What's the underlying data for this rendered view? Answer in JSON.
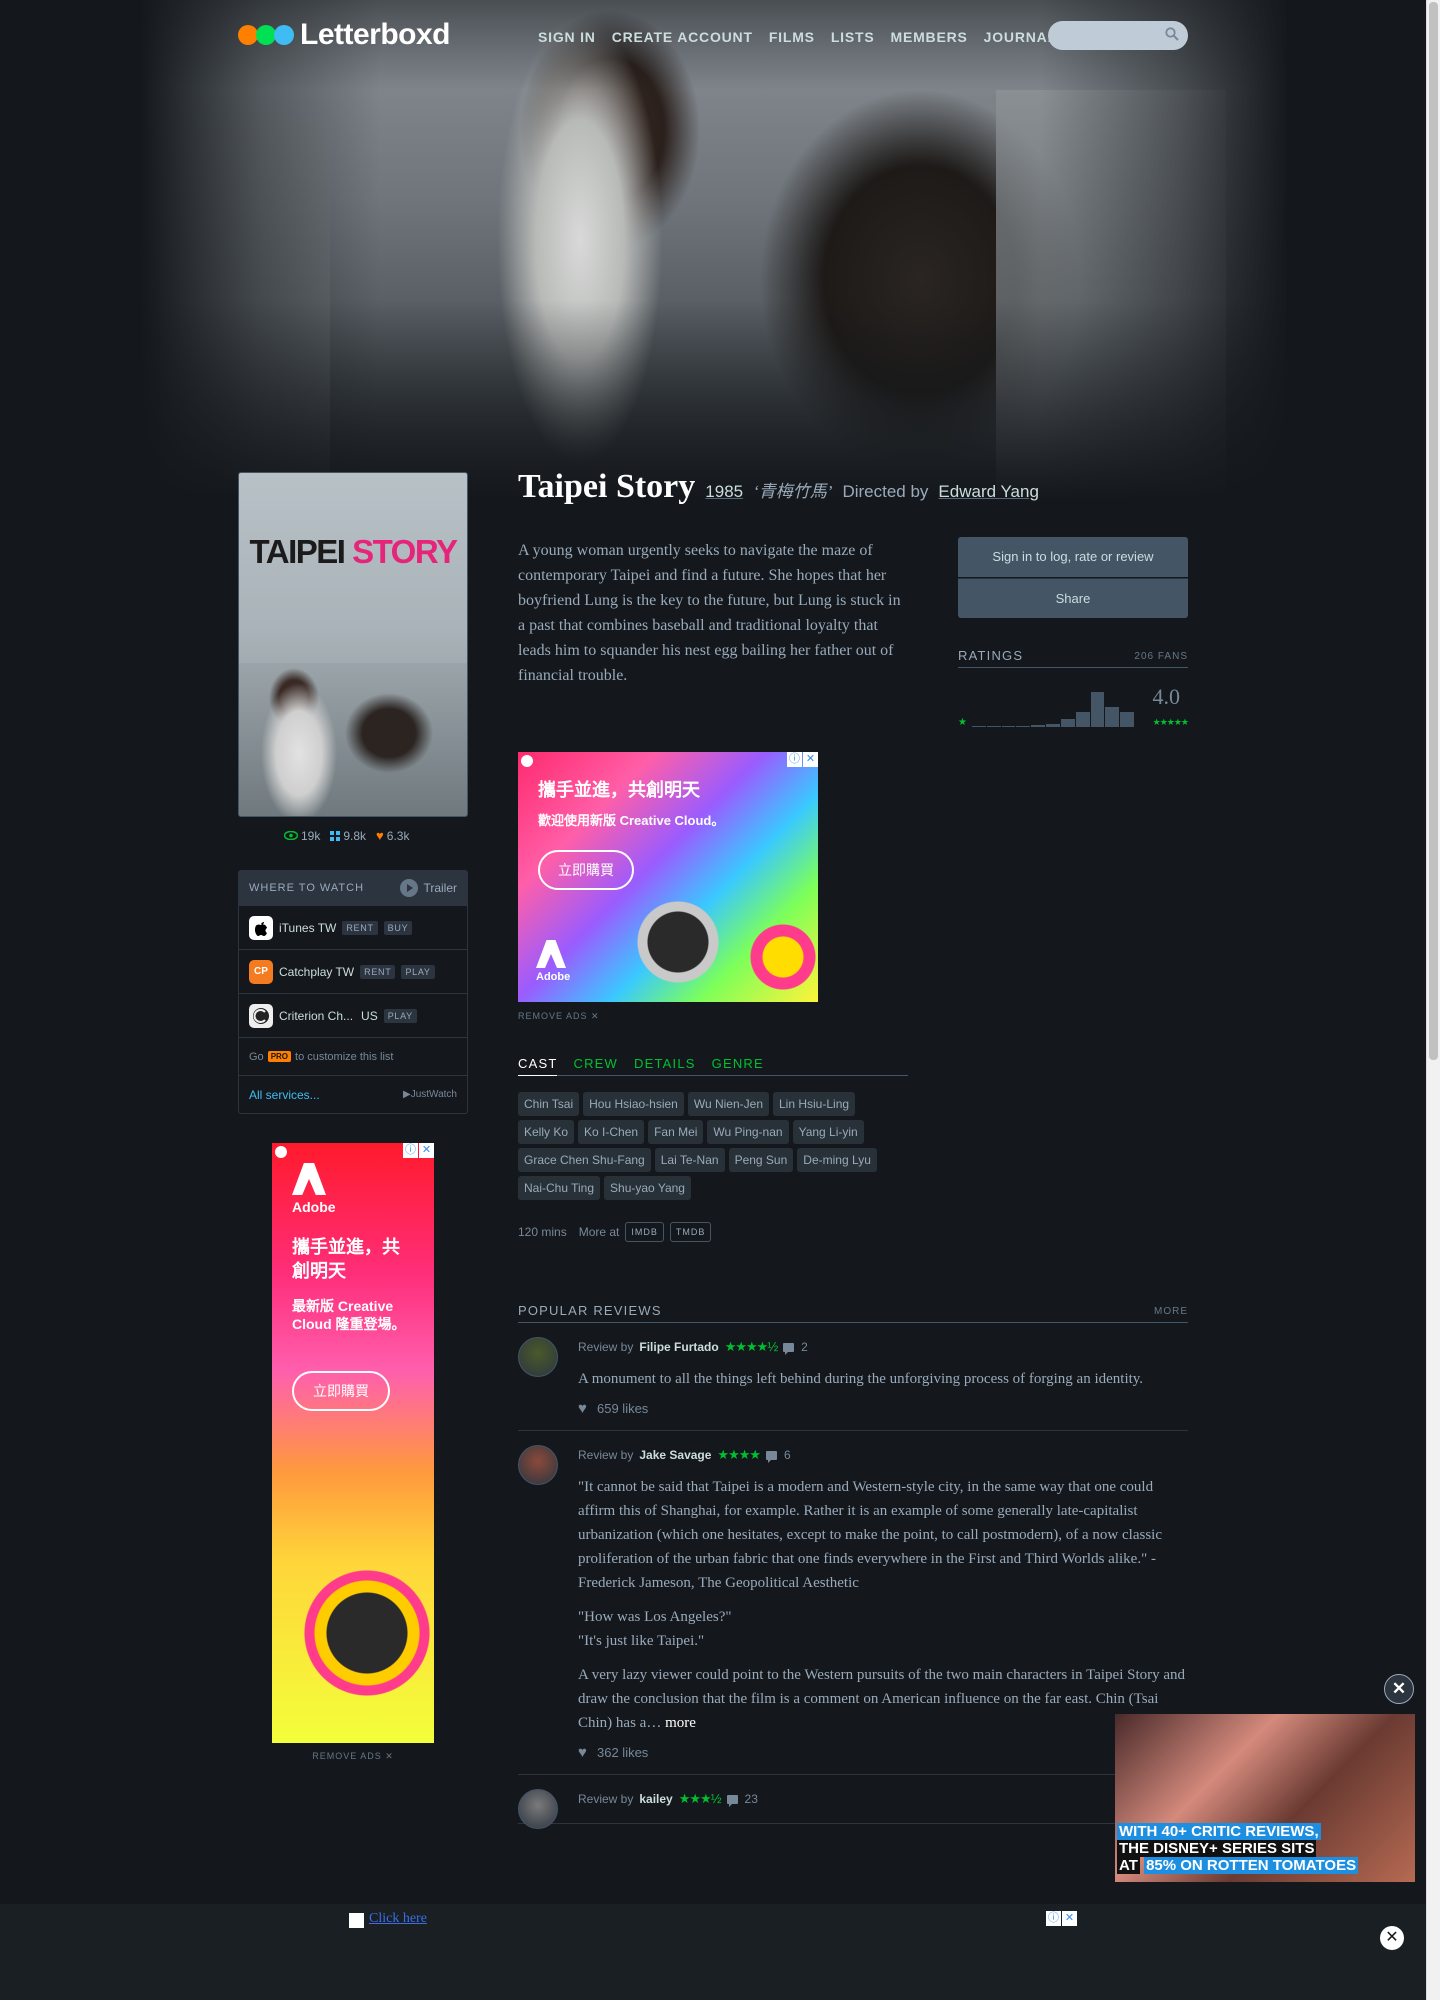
{
  "brand": {
    "name": "Letterboxd",
    "dot_colors": [
      "#ff8000",
      "#00e054",
      "#40bcf4"
    ]
  },
  "nav": {
    "items": [
      "Sign in",
      "Create account",
      "Films",
      "Lists",
      "Members",
      "Journal"
    ]
  },
  "search": {
    "placeholder": ""
  },
  "poster": {
    "title_word1": "TAIPEI",
    "title_word2": "STORY"
  },
  "stats": {
    "watched": "19k",
    "lists": "9.8k",
    "likes": "6.3k"
  },
  "watch": {
    "title": "Where to watch",
    "trailer": "Trailer",
    "services": [
      {
        "name": "iTunes TW",
        "region": "",
        "tags": [
          "RENT",
          "BUY"
        ],
        "icon": "apple-icon"
      },
      {
        "name": "Catchplay TW",
        "region": "",
        "tags": [
          "RENT",
          "PLAY"
        ],
        "icon": "catchplay-icon"
      },
      {
        "name": "Criterion Ch...",
        "region": "US",
        "tags": [
          "PLAY"
        ],
        "icon": "criterion-icon"
      }
    ],
    "note_go": "Go",
    "note_pro": "PRO",
    "note_rest": "to customize this list",
    "all_services": "All services...",
    "justwatch": "JustWatch"
  },
  "ads": {
    "remove": "Remove ads",
    "vertical": {
      "brand": "Adobe",
      "headline": "攜手並進，共創明天",
      "sub": "最新版 Creative Cloud 隆重登場。",
      "button": "立即購買"
    },
    "rect": {
      "brand": "Adobe",
      "headline": "攜手並進，共創明天",
      "sub": "歡迎使用新版 Creative Cloud。",
      "button": "立即購買"
    },
    "video": {
      "line1": "WITH 40+ CRITIC REVIEWS,",
      "line2": "THE DISNEY+ SERIES SITS",
      "line3a": "AT",
      "line3b": "85% ON ROTTEN TOMATOES"
    },
    "bottom": {
      "link": "Click here"
    }
  },
  "film": {
    "title": "Taipei Story",
    "year": "1985",
    "original_title": "‘青梅竹馬’",
    "directed_by": "Directed by",
    "director": "Edward Yang",
    "synopsis": "A young woman urgently seeks to navigate the maze of contemporary Taipei and find a future. She hopes that her boyfriend Lung is the key to the future, but Lung is stuck in a past that combines baseball and traditional loyalty that leads him to squander his nest egg bailing her father out of financial trouble."
  },
  "tabs": [
    "Cast",
    "Crew",
    "Details",
    "Genre"
  ],
  "cast": [
    "Chin Tsai",
    "Hou Hsiao-hsien",
    "Wu Nien-Jen",
    "Lin Hsiu-Ling",
    "Kelly Ko",
    "Ko I-Chen",
    "Fan Mei",
    "Wu Ping-nan",
    "Yang Li-yin",
    "Grace Chen Shu-Fang",
    "Lai Te-Nan",
    "Peng Sun",
    "De-ming Lyu",
    "Nai-Chu Ting",
    "Shu-yao Yang"
  ],
  "meta": {
    "runtime": "120 mins",
    "more_at": "More at",
    "imdb": "IMDB",
    "tmdb": "TMDB"
  },
  "actions": {
    "sign_in": "Sign in to log, rate or review",
    "share": "Share"
  },
  "ratings": {
    "title": "Ratings",
    "fans": "206 fans",
    "average": "4.0",
    "histogram": [
      0.01,
      0.02,
      0.02,
      0.03,
      0.05,
      0.06,
      0.17,
      0.33,
      0.77,
      0.43,
      0.32
    ]
  },
  "reviews": {
    "title": "Popular reviews",
    "more": "More",
    "review_by": "Review by",
    "items": [
      {
        "user": "Filipe Furtado",
        "stars": "★★★★½",
        "comments": "2",
        "paragraphs": [
          "A monument to all the things left behind during the unforgiving process of forging an identity."
        ],
        "likes": "659 likes",
        "avatar_color": "#4a5a2a"
      },
      {
        "user": "Jake Savage",
        "stars": "★★★★",
        "comments": "6",
        "paragraphs": [
          "\"It cannot be said that Taipei is a modern and Western-style city, in the same way that one could affirm this of Shanghai, for example. Rather it is an example of some generally late-capitalist urbanization (which one hesitates, except to make the point, to call postmodern), of a now classic proliferation of the urban fabric that one finds everywhere in the First and Third Worlds alike.\" - Frederick Jameson, The Geopolitical Aesthetic",
          "\"How was Los Angeles?\"\n\"It's just like Taipei.\"",
          "A very lazy viewer could point to the Western pursuits of the two main characters in Taipei Story and draw the conclusion that the film is a comment on American influence on the far east. Chin (Tsai Chin) has a…"
        ],
        "more": "more",
        "likes": "362 likes",
        "avatar_color": "#8a4a3a"
      },
      {
        "user": "kailey",
        "stars": "★★★½",
        "comments": "23",
        "paragraphs": [],
        "likes": "",
        "avatar_color": "#7a7a7a"
      }
    ]
  }
}
